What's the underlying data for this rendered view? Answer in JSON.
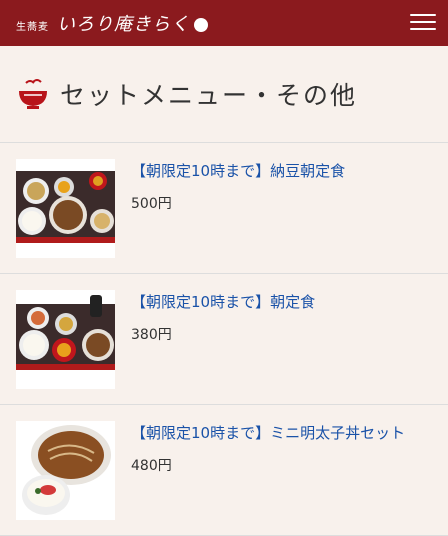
{
  "header": {
    "logo_small": "生蕎麦",
    "logo_main": "いろり庵きらく",
    "menu_icon": "hamburger-menu-icon",
    "bg_color": "#8b1a1e"
  },
  "section": {
    "title": "セットメニュー・その他",
    "icon": "bowl-icon"
  },
  "items": [
    {
      "title": "【朝限定10時まで】納豆朝定食",
      "price": "500円"
    },
    {
      "title": "【朝限定10時まで】朝定食",
      "price": "380円"
    },
    {
      "title": "【朝限定10時まで】ミニ明太子丼セット",
      "price": "480円"
    }
  ],
  "colors": {
    "link": "#1a52a8",
    "background": "#f8f1ec"
  }
}
